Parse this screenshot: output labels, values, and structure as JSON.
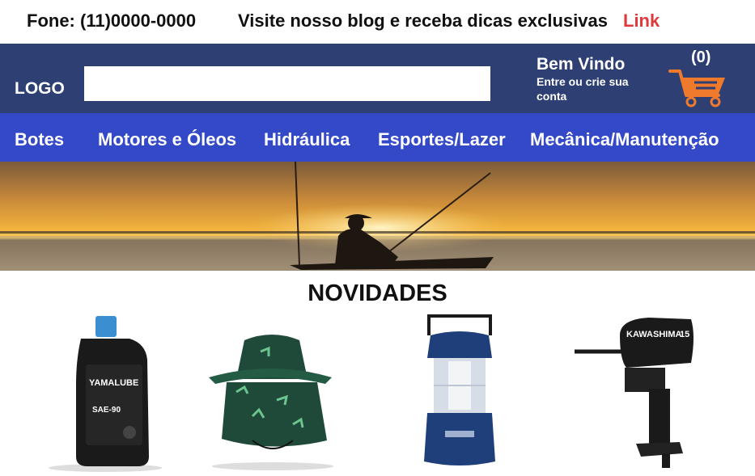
{
  "topbar": {
    "phone": "Fone: (11)0000-0000",
    "blog_text": "Visite nosso blog e receba dicas exclusivas",
    "link_label": "Link"
  },
  "header": {
    "logo": "LOGO",
    "search_value": "",
    "welcome_title": "Bem Vindo",
    "welcome_sub": "Entre ou crie sua conta",
    "cart_count": "(0)"
  },
  "nav": {
    "items": [
      "Botes",
      "Motores e Óleos",
      "Hidráulica",
      "Esportes/Lazer",
      "Mecânica/Manutenção"
    ]
  },
  "section": {
    "title": "NOVIDADES"
  },
  "products": {
    "oil": {
      "brand": "YAMALUBE",
      "grade": "SAE-90",
      "icon": "oil-bottle-image"
    },
    "hat": {
      "icon": "fishing-hat-image"
    },
    "lantern": {
      "icon": "camping-lantern-image"
    },
    "motor": {
      "brand": "KAWASHIMA",
      "model": "15",
      "icon": "outboard-motor-image"
    }
  },
  "colors": {
    "accent_link": "#e0393c",
    "header_bg": "#2e3f73",
    "nav_bg": "#3449c8",
    "cart_orange": "#f07a2b"
  }
}
